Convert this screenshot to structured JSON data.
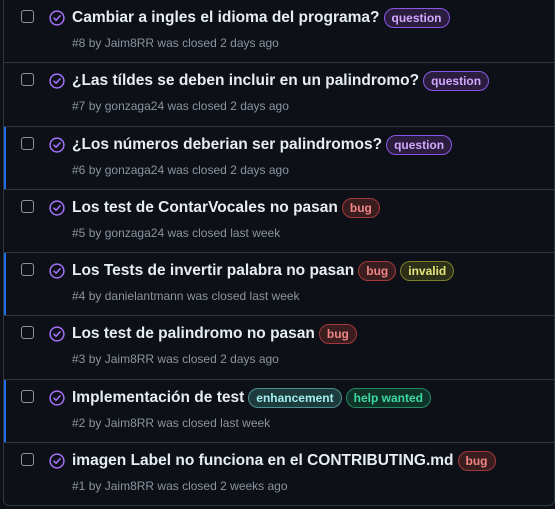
{
  "colors": {
    "closed_icon": "#a371f7",
    "accent_bar": "#1f6feb",
    "question": "#d2a8ff",
    "bug": "#f08585",
    "invalid": "#e3e67c",
    "enhancement": "#a2eeef",
    "help_wanted": "#3fd8a0"
  },
  "issues": [
    {
      "title": "Cambiar a ingles el idioma del programa?",
      "labels": [
        {
          "text": "question",
          "kind": "question"
        }
      ],
      "number": "#8",
      "by": "by",
      "author": "Jaim8RR",
      "status": "was closed",
      "time": "2 days ago",
      "accent": false
    },
    {
      "title": "¿Las tíldes se deben incluir en un palindromo?",
      "labels": [
        {
          "text": "question",
          "kind": "question"
        }
      ],
      "number": "#7",
      "by": "by",
      "author": "gonzaga24",
      "status": "was closed",
      "time": "2 days ago",
      "accent": false
    },
    {
      "title": "¿Los números deberian ser palindromos?",
      "labels": [
        {
          "text": "question",
          "kind": "question"
        }
      ],
      "number": "#6",
      "by": "by",
      "author": "gonzaga24",
      "status": "was closed",
      "time": "2 days ago",
      "accent": true
    },
    {
      "title": "Los test de ContarVocales no pasan",
      "labels": [
        {
          "text": "bug",
          "kind": "bug"
        }
      ],
      "number": "#5",
      "by": "by",
      "author": "gonzaga24",
      "status": "was closed",
      "time": "last week",
      "accent": false
    },
    {
      "title": "Los Tests de invertir palabra no pasan",
      "labels": [
        {
          "text": "bug",
          "kind": "bug"
        },
        {
          "text": "invalid",
          "kind": "invalid"
        }
      ],
      "number": "#4",
      "by": "by",
      "author": "danielantmann",
      "status": "was closed",
      "time": "last week",
      "accent": true
    },
    {
      "title": "Los test de palindromo no pasan",
      "labels": [
        {
          "text": "bug",
          "kind": "bug"
        }
      ],
      "number": "#3",
      "by": "by",
      "author": "Jaim8RR",
      "status": "was closed",
      "time": "2 days ago",
      "accent": false
    },
    {
      "title": "Implementación de test",
      "labels": [
        {
          "text": "enhancement",
          "kind": "enhancement"
        },
        {
          "text": "help wanted",
          "kind": "helpwanted"
        }
      ],
      "number": "#2",
      "by": "by",
      "author": "Jaim8RR",
      "status": "was closed",
      "time": "last week",
      "accent": true
    },
    {
      "title": "imagen Label no funciona en el CONTRIBUTING.md",
      "labels": [
        {
          "text": "bug",
          "kind": "bug"
        }
      ],
      "number": "#1",
      "by": "by",
      "author": "Jaim8RR",
      "status": "was closed",
      "time": "2 weeks ago",
      "accent": false
    }
  ]
}
